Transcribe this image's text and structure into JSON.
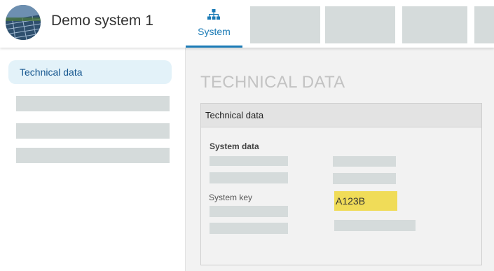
{
  "header": {
    "system_name": "Demo system 1",
    "avatar_icon": "solar-panels-photo",
    "active_tab": {
      "label": "System",
      "icon": "hierarchy-icon",
      "accent": "#1b7bb6"
    }
  },
  "sidebar": {
    "active_item": "Technical data",
    "active_bg": "#e3f2f9"
  },
  "main": {
    "page_title": "TECHNICAL DATA",
    "panel": {
      "title": "Technical data",
      "section_title": "System data",
      "fields": {
        "system_key_label": "System key",
        "system_key_value": "A123B",
        "highlight_color": "#f0dc58"
      }
    }
  }
}
